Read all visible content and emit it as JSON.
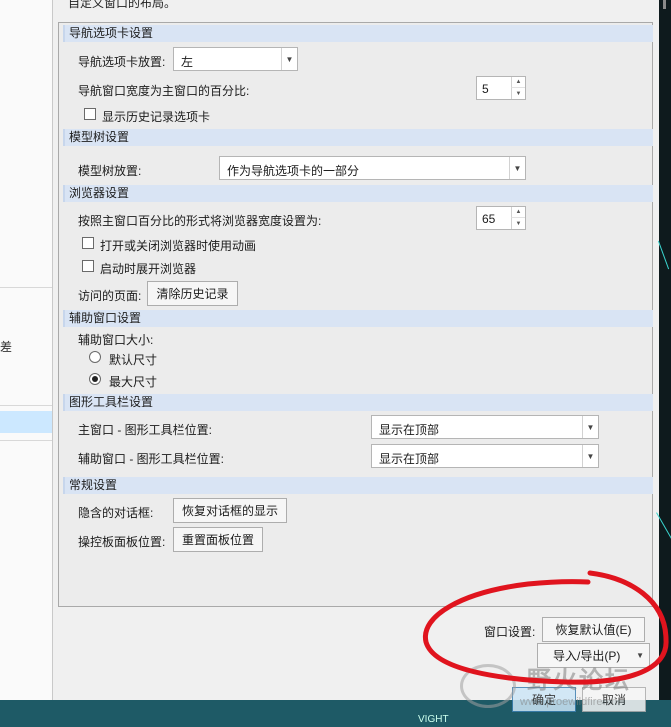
{
  "description_text": "自定义窗口的布局。",
  "sections": {
    "nav": {
      "title": "导航选项卡设置",
      "placement_label": "导航选项卡放置:",
      "placement_value": "左",
      "width_label": "导航窗口宽度为主窗口的百分比:",
      "width_value": "5",
      "history_label": "显示历史记录选项卡"
    },
    "tree": {
      "title": "模型树设置",
      "placement_label": "模型树放置:",
      "placement_value": "作为导航选项卡的一部分"
    },
    "browser": {
      "title": "浏览器设置",
      "width_label": "按照主窗口百分比的形式将浏览器宽度设置为:",
      "width_value": "65",
      "anim_label": "打开或关闭浏览器时使用动画",
      "expand_label": "启动时展开浏览器",
      "visited_label": "访问的页面:",
      "clear_history": "清除历史记录"
    },
    "aux": {
      "title": "辅助窗口设置",
      "size_label": "辅助窗口大小:",
      "default_size": "默认尺寸",
      "max_size": "最大尺寸",
      "selected": "max"
    },
    "toolbar": {
      "title": "图形工具栏设置",
      "main_label": "主窗口 - 图形工具栏位置:",
      "main_value": "显示在顶部",
      "aux_label": "辅助窗口 - 图形工具栏位置:",
      "aux_value": "显示在顶部"
    },
    "general": {
      "title": "常规设置",
      "hidden_label": "隐含的对话框:",
      "restore_dialogs": "恢复对话框的显示",
      "panel_label": "操控板面板位置:",
      "reset_panel": "重置面板位置"
    }
  },
  "footer": {
    "window_settings_label": "窗口设置:",
    "restore_defaults": "恢复默认值(E)",
    "import_export": "导入/导出(P)",
    "ok": "确定",
    "cancel": "取消"
  },
  "watermark": {
    "text": "野火论坛",
    "url": "www.proewildfire.cn"
  },
  "bottom_label": "VIGHT",
  "left_glyph": "差",
  "colors": {
    "section_header": "#d9e4f4",
    "annotation": "#e0141e",
    "primary_button": "#cde6f7"
  }
}
